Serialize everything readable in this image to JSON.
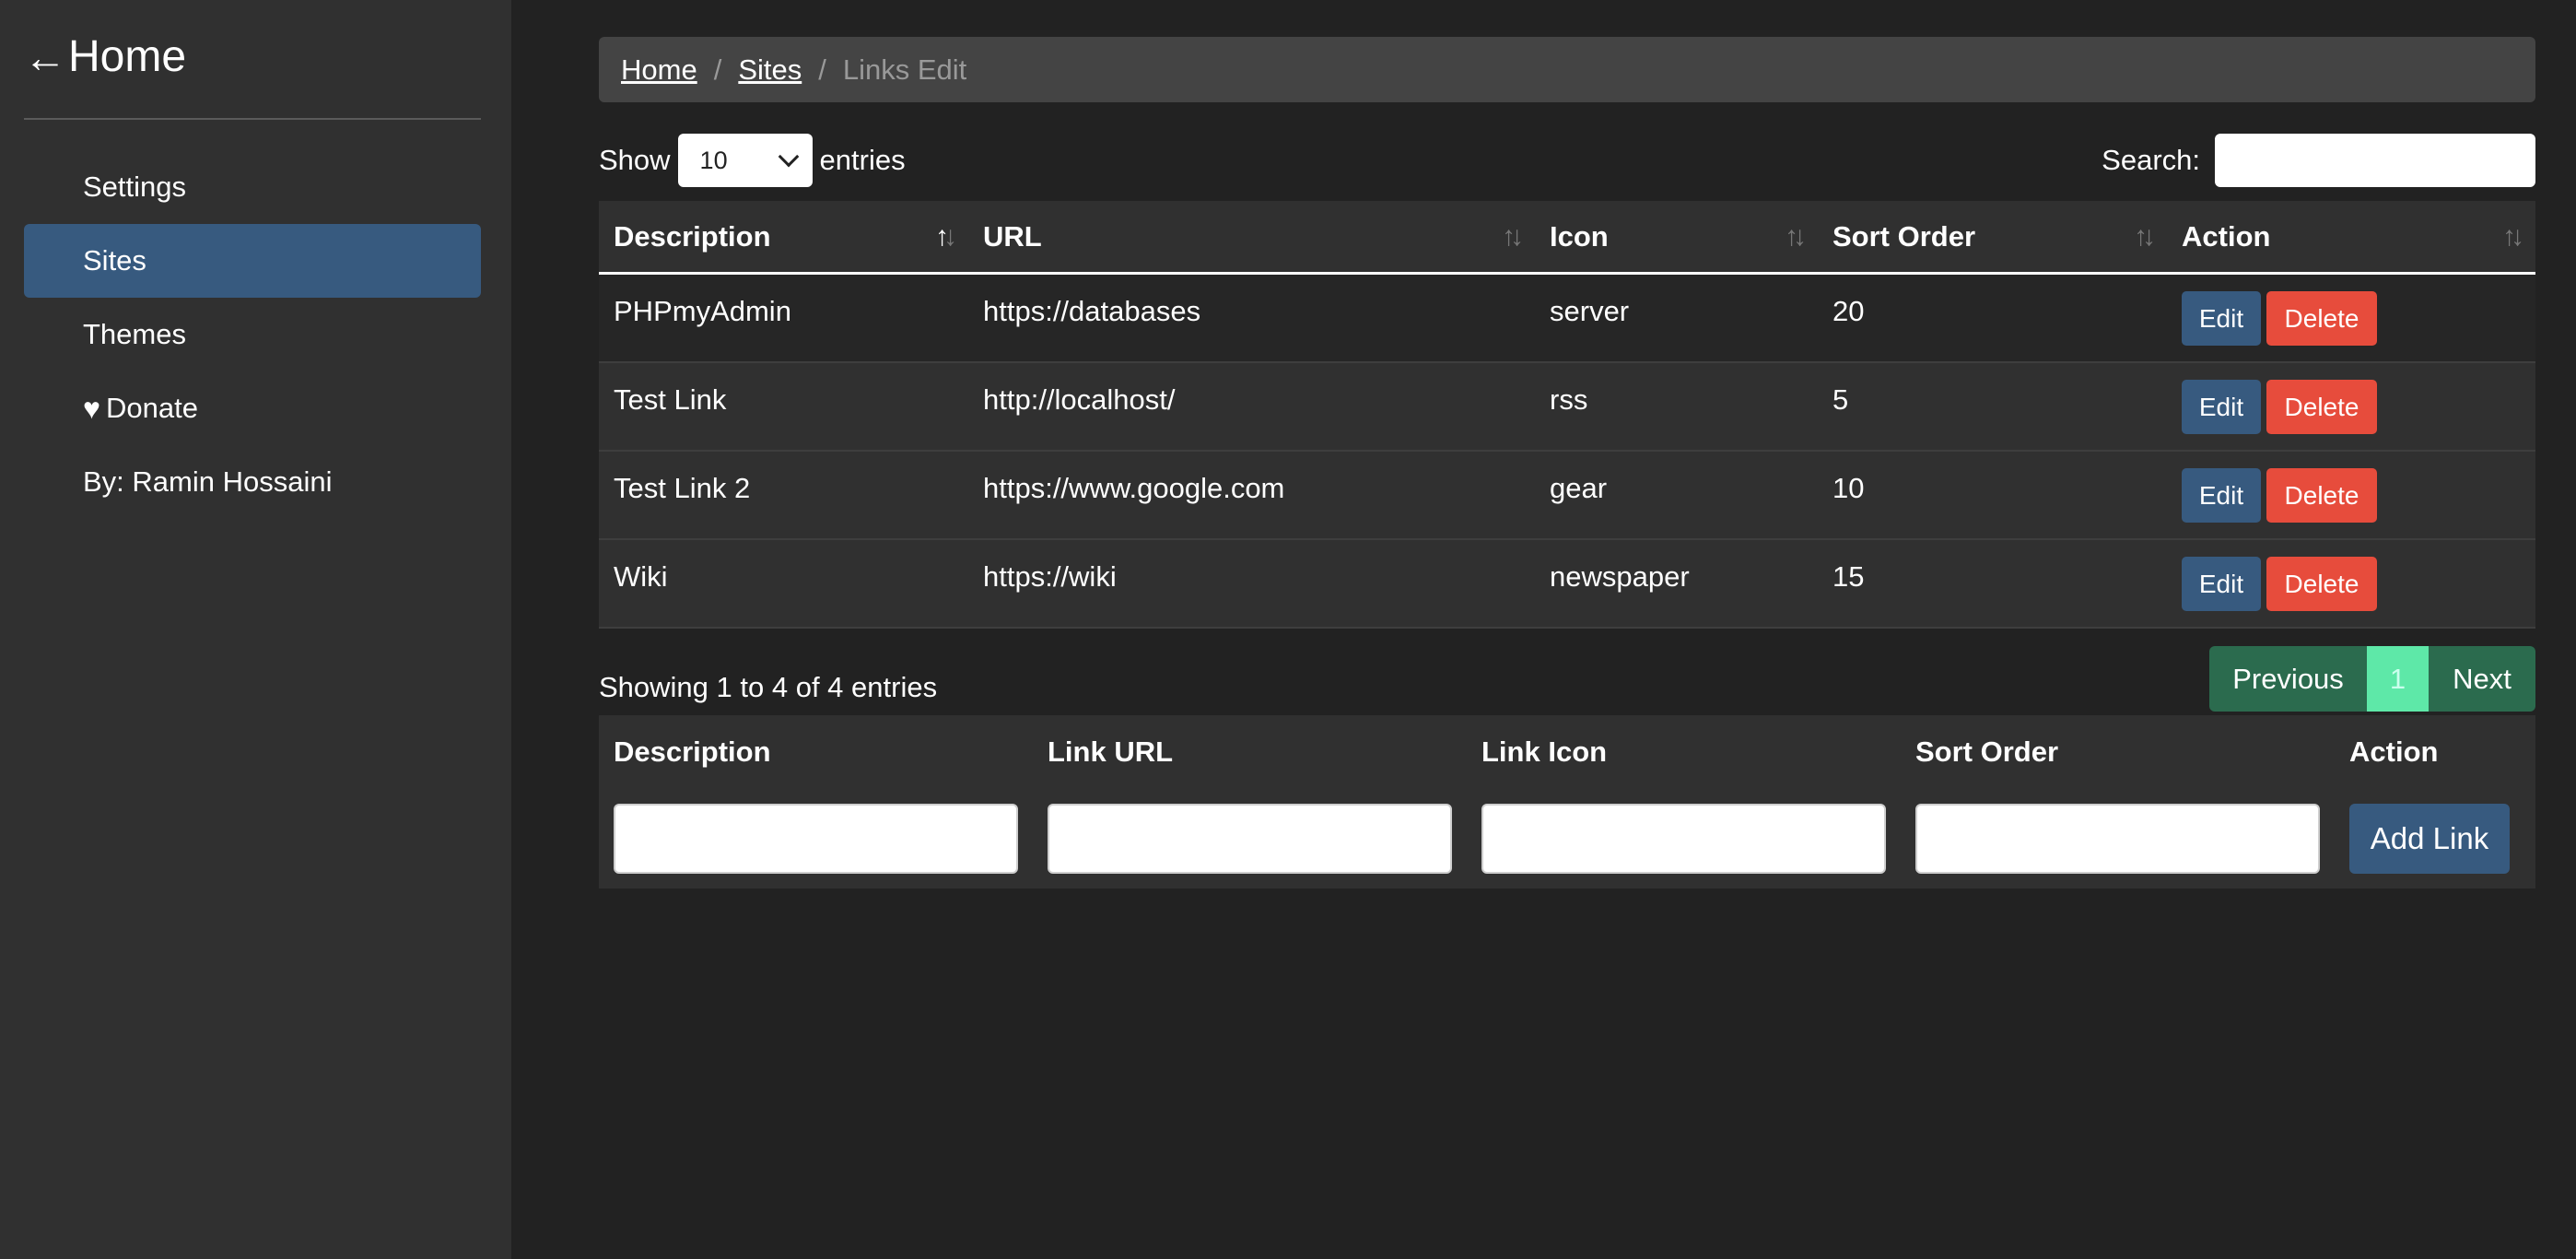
{
  "sidebar": {
    "home_label": "Home",
    "items": [
      {
        "label": "Settings"
      },
      {
        "label": "Sites"
      },
      {
        "label": "Themes"
      },
      {
        "label": "Donate"
      },
      {
        "label": "By: Ramin Hossaini"
      }
    ],
    "active_item": "Sites"
  },
  "breadcrumb": {
    "home": "Home",
    "sites": "Sites",
    "current": "Links Edit"
  },
  "table_controls": {
    "show_label": "Show",
    "entries_value": "10",
    "entries_label": "entries",
    "search_label": "Search:",
    "search_value": ""
  },
  "table": {
    "columns": [
      "Description",
      "URL",
      "Icon",
      "Sort Order",
      "Action"
    ],
    "rows": [
      {
        "description": "PHPmyAdmin",
        "url": "https://databases",
        "icon": "server",
        "sort_order": "20"
      },
      {
        "description": "Test Link",
        "url": "http://localhost/",
        "icon": "rss",
        "sort_order": "5"
      },
      {
        "description": "Test Link 2",
        "url": "https://www.google.com",
        "icon": "gear",
        "sort_order": "10"
      },
      {
        "description": "Wiki",
        "url": "https://wiki",
        "icon": "newspaper",
        "sort_order": "15"
      }
    ],
    "edit_label": "Edit",
    "delete_label": "Delete"
  },
  "footer": {
    "showing_text": "Showing 1 to 4 of 4 entries",
    "prev_label": "Previous",
    "page": "1",
    "next_label": "Next"
  },
  "add_form": {
    "headers": [
      "Description",
      "Link URL",
      "Link Icon",
      "Sort Order",
      "Action"
    ],
    "add_button": "Add Link"
  },
  "colors": {
    "background": "#222222",
    "sidebar": "#303030",
    "primary": "#375a7f",
    "danger": "#e74c3c",
    "success": "#2b6b4e"
  }
}
